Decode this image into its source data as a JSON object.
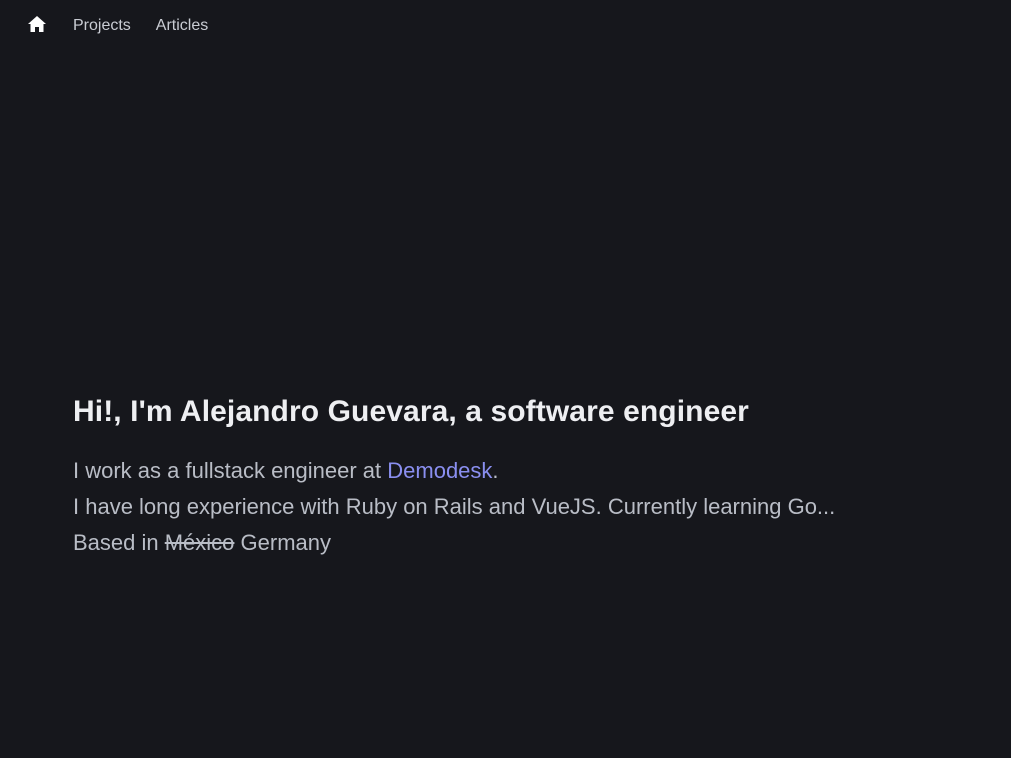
{
  "nav": {
    "home_icon": "home-icon",
    "links": [
      "Projects",
      "Articles"
    ]
  },
  "hero": {
    "title": "Hi!, I'm Alejandro Guevara, a software engineer",
    "line1_prefix": "I work as a fullstack engineer at ",
    "company": "Demodesk",
    "line1_suffix": ".",
    "line2": "I have long experience with Ruby on Rails and VueJS. Currently learning Go...",
    "line3_prefix": "Based in ",
    "former_location": "México",
    "current_location": " Germany"
  },
  "colors": {
    "background": "#16171c",
    "title": "#eeeff2",
    "body_text": "#b9bdc6",
    "link": "#8a8ff0"
  }
}
